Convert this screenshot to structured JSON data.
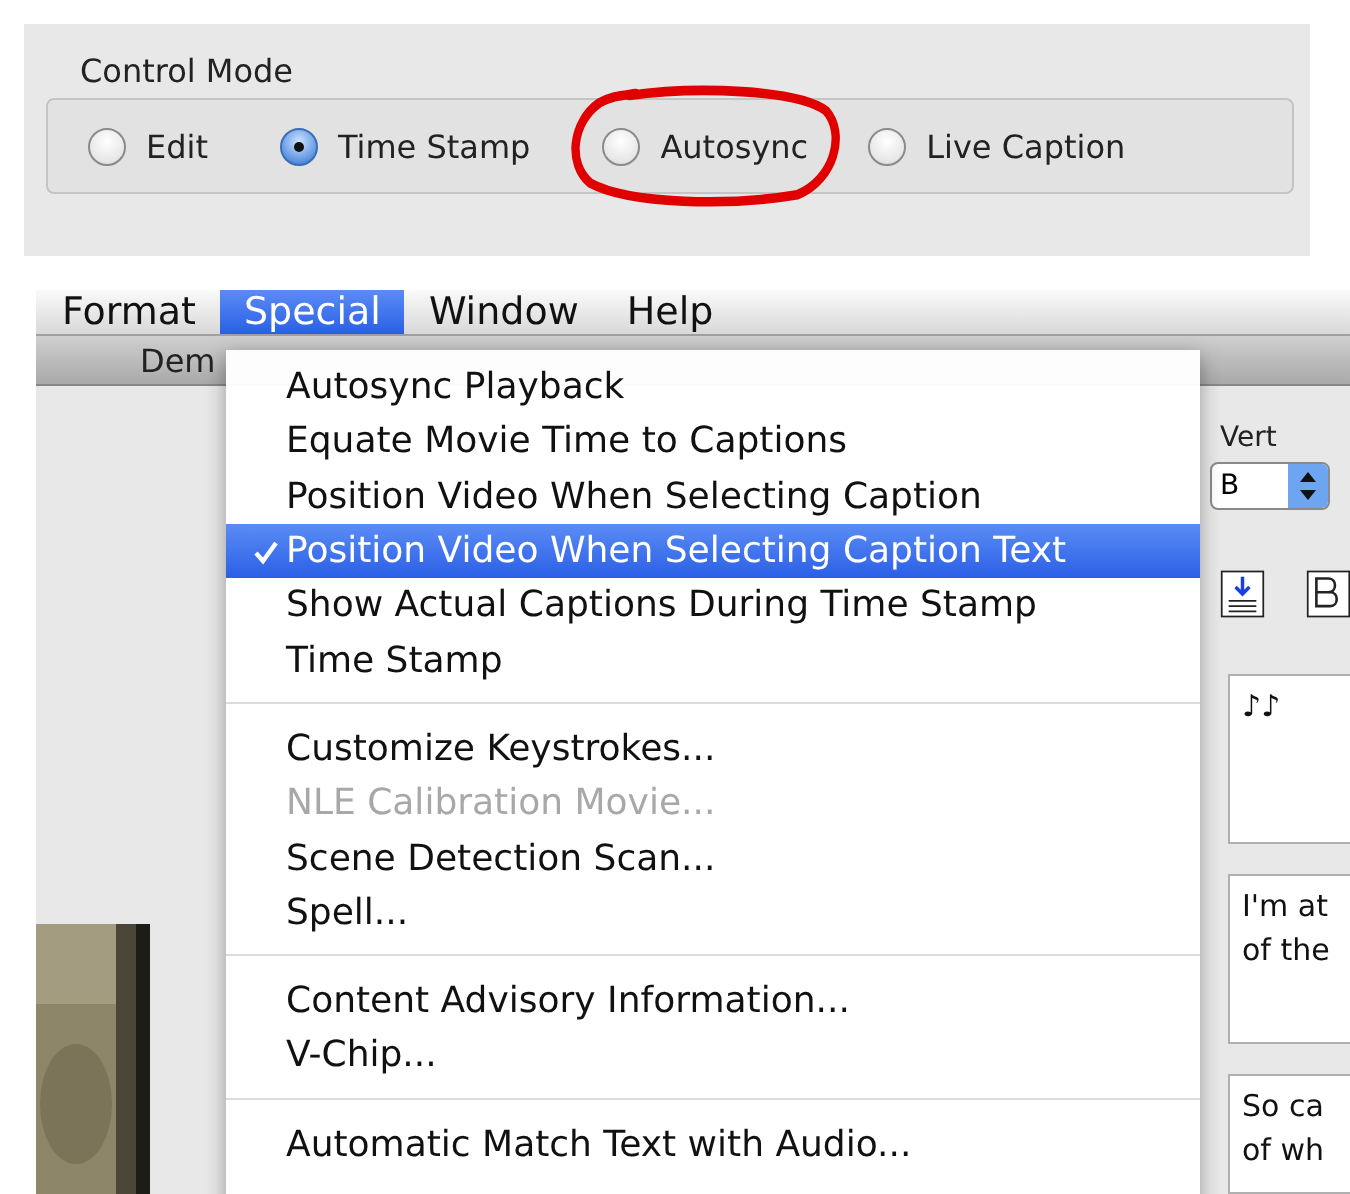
{
  "control_mode": {
    "title": "Control Mode",
    "options": [
      {
        "label": "Edit",
        "selected": false,
        "circled": false
      },
      {
        "label": "Time Stamp",
        "selected": true,
        "circled": false
      },
      {
        "label": "Autosync",
        "selected": false,
        "circled": true
      },
      {
        "label": "Live Caption",
        "selected": false,
        "circled": false
      }
    ]
  },
  "menubar": [
    {
      "label": "Format",
      "selected": false
    },
    {
      "label": "Special",
      "selected": true
    },
    {
      "label": "Window",
      "selected": false
    },
    {
      "label": "Help",
      "selected": false
    }
  ],
  "window": {
    "title": "Dem"
  },
  "menu": {
    "items": [
      {
        "kind": "item",
        "label": "Autosync Playback",
        "checked": false,
        "disabled": false,
        "highlighted": false
      },
      {
        "kind": "item",
        "label": "Equate Movie Time to Captions",
        "checked": false,
        "disabled": false,
        "highlighted": false
      },
      {
        "kind": "item",
        "label": "Position Video When Selecting Caption",
        "checked": false,
        "disabled": false,
        "highlighted": false
      },
      {
        "kind": "item",
        "label": "Position Video When Selecting Caption Text",
        "checked": true,
        "disabled": false,
        "highlighted": true
      },
      {
        "kind": "item",
        "label": "Show Actual Captions During Time Stamp",
        "checked": false,
        "disabled": false,
        "highlighted": false
      },
      {
        "kind": "item",
        "label": "Time Stamp",
        "checked": false,
        "disabled": false,
        "highlighted": false
      },
      {
        "kind": "separator"
      },
      {
        "kind": "item",
        "label": "Customize Keystrokes...",
        "checked": false,
        "disabled": false,
        "highlighted": false
      },
      {
        "kind": "item",
        "label": "NLE Calibration Movie...",
        "checked": false,
        "disabled": true,
        "highlighted": false
      },
      {
        "kind": "item",
        "label": "Scene Detection Scan...",
        "checked": false,
        "disabled": false,
        "highlighted": false
      },
      {
        "kind": "item",
        "label": "Spell...",
        "checked": false,
        "disabled": false,
        "highlighted": false
      },
      {
        "kind": "separator"
      },
      {
        "kind": "item",
        "label": "Content Advisory Information...",
        "checked": false,
        "disabled": false,
        "highlighted": false
      },
      {
        "kind": "item",
        "label": "V-Chip...",
        "checked": false,
        "disabled": false,
        "highlighted": false
      },
      {
        "kind": "separator"
      },
      {
        "kind": "item",
        "label": "Automatic Match Text with Audio...",
        "checked": false,
        "disabled": false,
        "highlighted": false
      }
    ]
  },
  "vert": {
    "label": "Vert",
    "value": "B"
  },
  "captions": [
    {
      "lines": [
        "♪♪"
      ]
    },
    {
      "lines": [
        "I'm at",
        "of the"
      ]
    },
    {
      "lines": [
        "So ca",
        "of wh"
      ]
    }
  ]
}
